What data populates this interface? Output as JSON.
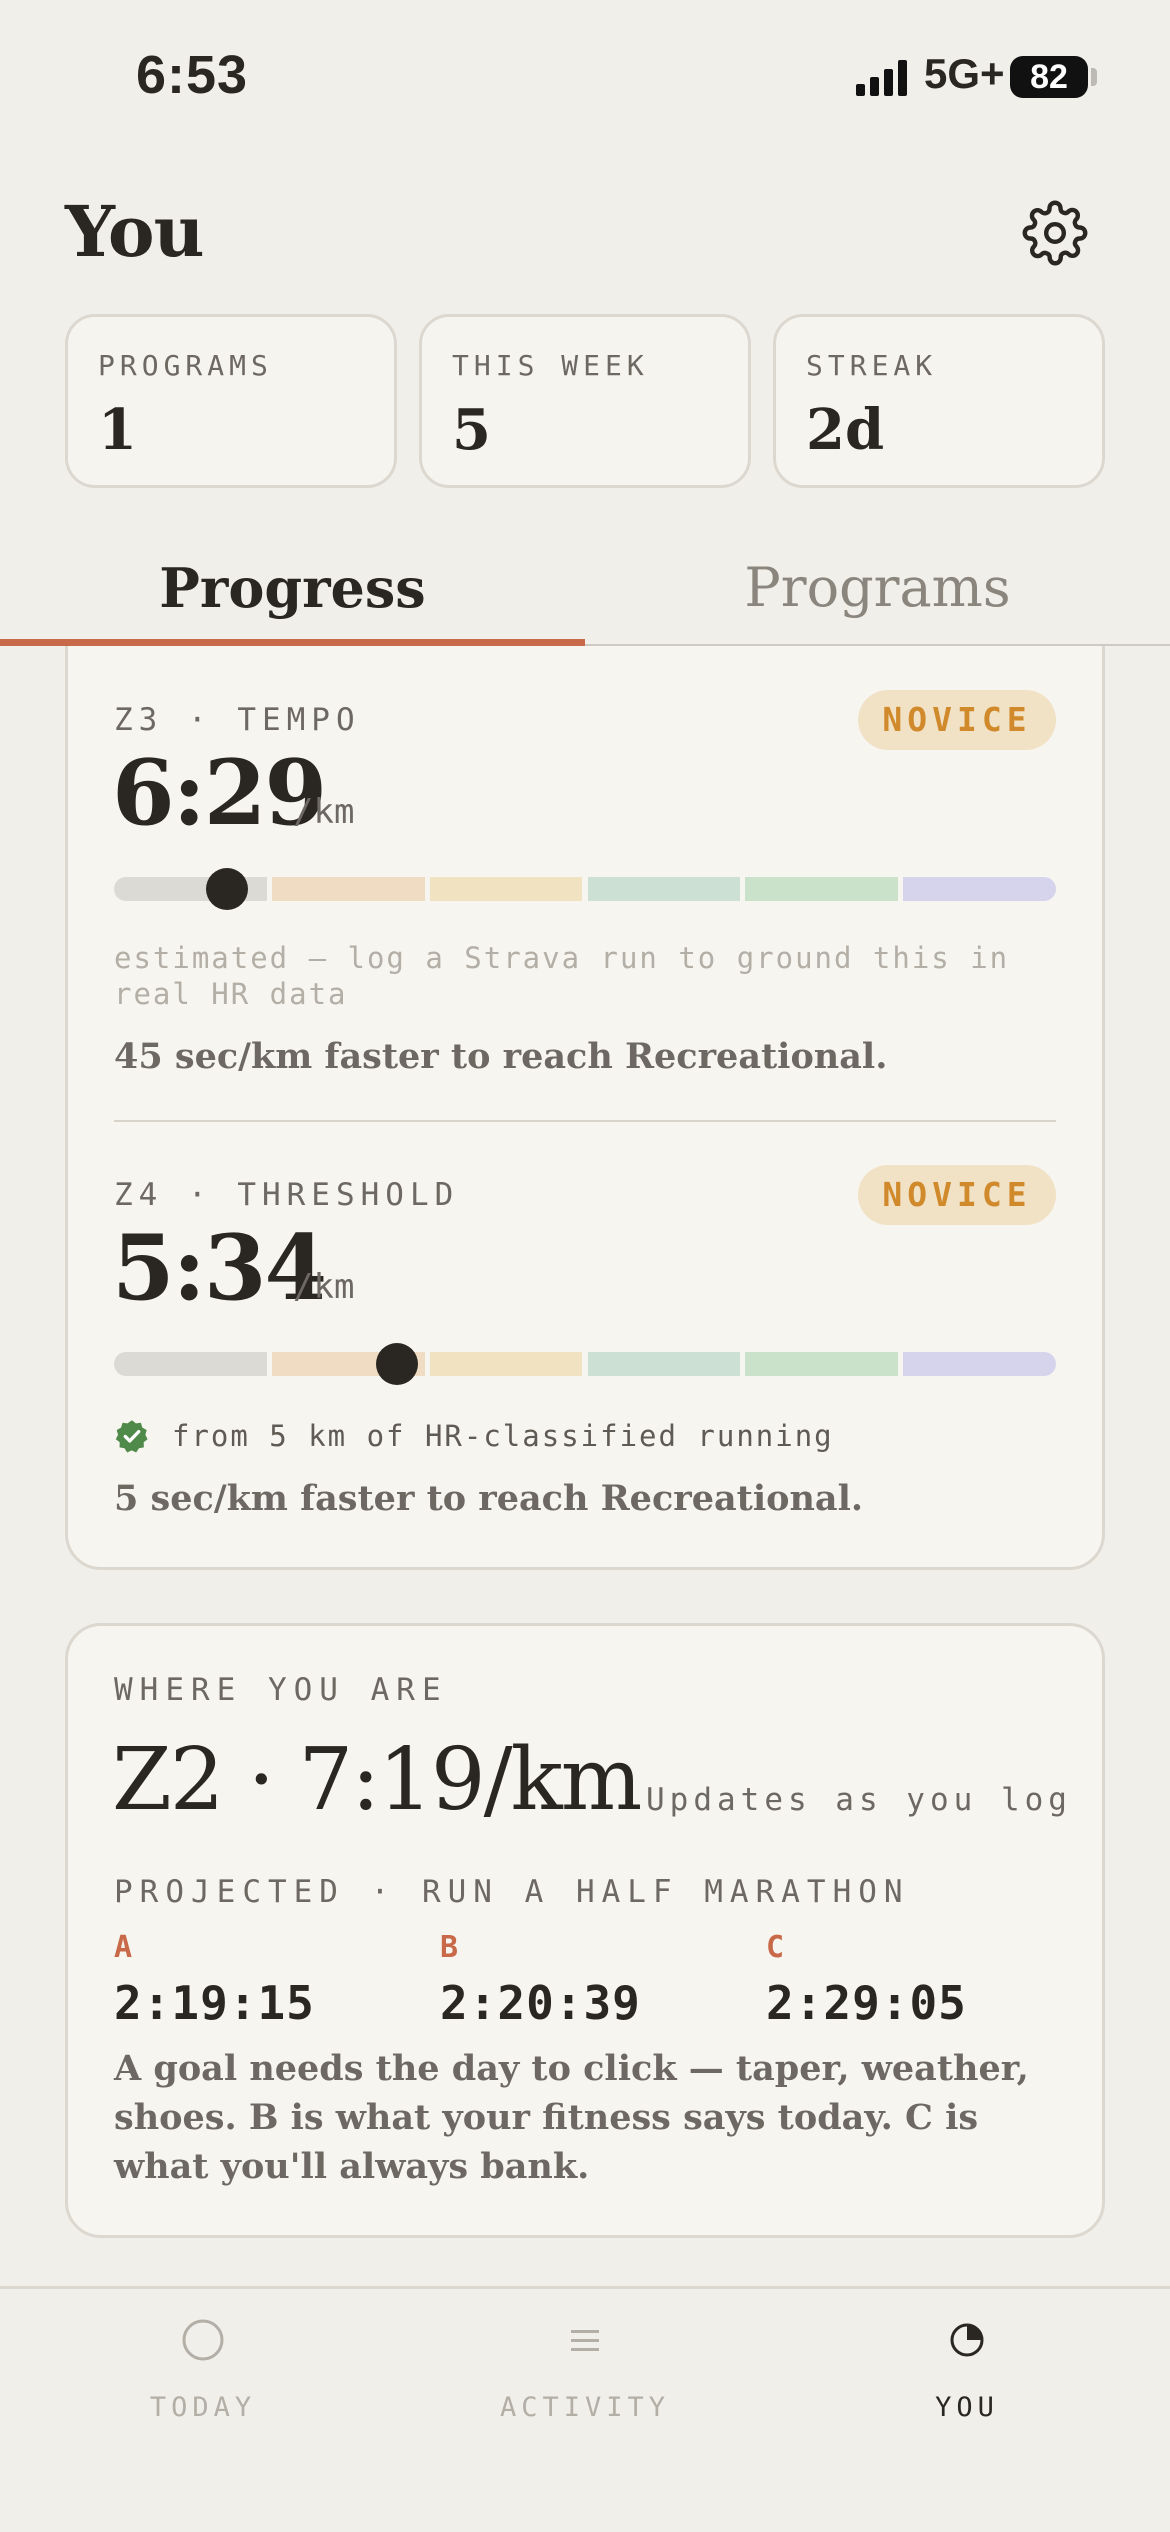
{
  "status_bar": {
    "time": "6:53",
    "network": "5G+",
    "battery": "82"
  },
  "header": {
    "title": "You",
    "settings_icon": "gear-icon"
  },
  "stats": [
    {
      "label": "PROGRAMS",
      "value": "1"
    },
    {
      "label": "THIS WEEK",
      "value": "5"
    },
    {
      "label": "STREAK",
      "value": "2d"
    }
  ],
  "tabs": [
    {
      "label": "Progress",
      "active": true
    },
    {
      "label": "Programs",
      "active": false
    }
  ],
  "zones": [
    {
      "heading": "Z3 · TEMPO",
      "level": "NOVICE",
      "pace": "6:29",
      "unit": "/km",
      "marker_position": 0.12,
      "note": "estimated — log a Strava run to ground this in real HR data",
      "message": "45 sec/km faster to reach Recreational."
    },
    {
      "heading": "Z4 · THRESHOLD",
      "level": "NOVICE",
      "pace": "5:34",
      "unit": "/km",
      "marker_position": 0.3,
      "note": "from 5 km of HR-classified running",
      "message": "5 sec/km faster to reach Recreational."
    }
  ],
  "zone_scale_colors": [
    "#dcdad5",
    "#efdcc2",
    "#f1e2c1",
    "#cde0d4",
    "#c9e2c9",
    "#d6d4ec"
  ],
  "where": {
    "heading": "WHERE YOU ARE",
    "value": "Z2 · 7:19/km",
    "hint": "Updates as you log",
    "projected_heading": "PROJECTED · RUN A HALF MARATHON",
    "goals": [
      {
        "letter": "A",
        "time": "2:19:15"
      },
      {
        "letter": "B",
        "time": "2:20:39"
      },
      {
        "letter": "C",
        "time": "2:29:05"
      }
    ],
    "explanation": "A goal needs the day to click — taper, weather, shoes. B is what your fitness says today. C is what you'll always bank."
  },
  "nav": [
    {
      "label": "TODAY",
      "icon": "circle-icon",
      "active": false
    },
    {
      "label": "ACTIVITY",
      "icon": "list-icon",
      "active": false
    },
    {
      "label": "YOU",
      "icon": "pie-chart-icon",
      "active": true
    }
  ],
  "colors": {
    "accent": "#c8694a",
    "badge_text": "#d08a2c",
    "background": "#f1efe9"
  }
}
